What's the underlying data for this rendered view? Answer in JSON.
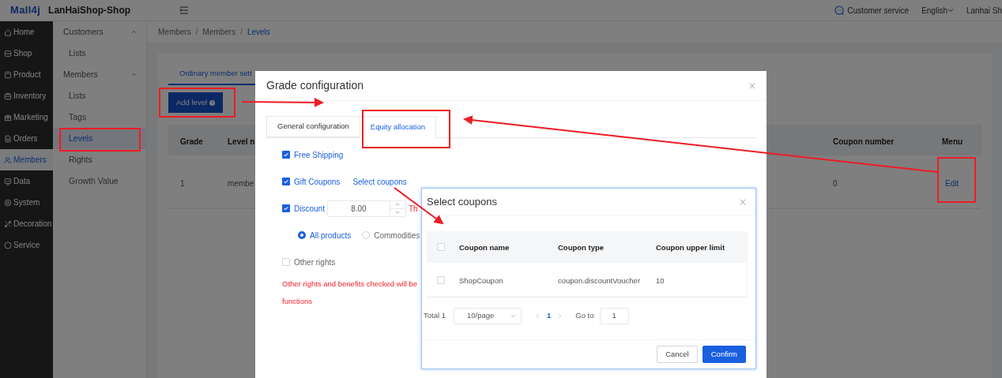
{
  "topbar": {
    "logo": "Mall4j",
    "shop_name": "LanHaiShop-Shop",
    "service": "Customer service",
    "language": "English",
    "user": "Lanhai Sh"
  },
  "sidebar": {
    "items": [
      {
        "label": "Home",
        "selected": false
      },
      {
        "label": "Shop",
        "selected": false
      },
      {
        "label": "Product",
        "selected": false
      },
      {
        "label": "Inventory",
        "selected": false
      },
      {
        "label": "Marketing",
        "selected": false
      },
      {
        "label": "Orders",
        "selected": false
      },
      {
        "label": "Members",
        "selected": true
      },
      {
        "label": "Data",
        "selected": false
      },
      {
        "label": "System",
        "selected": false
      },
      {
        "label": "Decoration",
        "selected": false
      },
      {
        "label": "Service",
        "selected": false
      }
    ]
  },
  "subnav": [
    {
      "label": "Customers",
      "expanded": true,
      "children": [
        {
          "label": "Lists",
          "selected": false
        }
      ]
    },
    {
      "label": "Members",
      "expanded": true,
      "children": [
        {
          "label": "Lists",
          "selected": false
        },
        {
          "label": "Tags",
          "selected": false
        },
        {
          "label": "Levels",
          "selected": true
        },
        {
          "label": "Rights",
          "selected": false
        },
        {
          "label": "Growth Value",
          "selected": false
        }
      ]
    }
  ],
  "breadcrumb": [
    {
      "kind": "link",
      "label": "Members"
    },
    {
      "kind": "separator",
      "label": "/"
    },
    {
      "kind": "link",
      "label": "Members"
    },
    {
      "kind": "separator",
      "label": "/"
    },
    {
      "kind": "current",
      "label": "Levels"
    }
  ],
  "page_tab": "Ordinary member sett",
  "add_button": "Add level",
  "table": {
    "columns": [
      "Grade",
      "Level n",
      "Coupon number",
      "Menu"
    ],
    "rows": [
      {
        "cells": [
          "1",
          "membe",
          "0"
        ],
        "action": "Edit"
      }
    ]
  },
  "grade_dialog": {
    "title": "Grade configuration",
    "tabs": [
      {
        "label": "General configuration",
        "selected": false
      },
      {
        "label": "Equity allocation",
        "selected": true
      }
    ],
    "options": [
      {
        "kind": "checkbox",
        "label": "Free Shipping",
        "checked": true
      },
      {
        "kind": "coupons",
        "label": "Gift Coupons",
        "checked": true,
        "link": "Select coupons"
      },
      {
        "kind": "discount",
        "label": "Discount",
        "checked": true,
        "value": "8.00",
        "note": "Th"
      },
      {
        "kind": "radios",
        "radios": [
          {
            "label": "All products",
            "selected": true
          },
          {
            "label": "Commodities",
            "selected": false
          }
        ]
      },
      {
        "kind": "checkbox",
        "label": "Other rights",
        "checked": false
      }
    ],
    "warning": [
      "Other rights and benefits checked will be",
      "functions"
    ]
  },
  "coupon_dialog": {
    "title": "Select coupons",
    "columns": [
      "Coupon name",
      "Coupon type",
      "Coupon upper limit"
    ],
    "all_checked": false,
    "rows": [
      {
        "checked": false,
        "cells": [
          "ShopCoupon",
          "coupon.discountVoucher",
          "10"
        ]
      }
    ],
    "total": "Total 1",
    "page_size": "10/page",
    "pages": [
      {
        "label": "1",
        "selected": true
      }
    ],
    "goto_label": "Go to",
    "goto_value": "1",
    "buttons": [
      {
        "kind": "secondary",
        "label": "Cancel"
      },
      {
        "kind": "primary",
        "label": "Confirm"
      }
    ]
  }
}
